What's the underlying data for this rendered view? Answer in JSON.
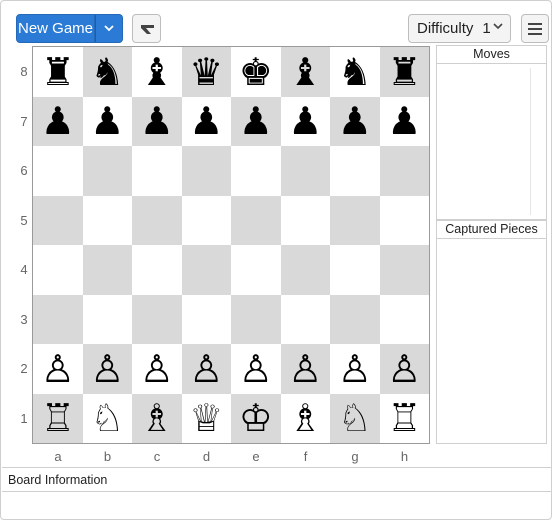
{
  "toolbar": {
    "new_game_label": "New Game",
    "difficulty_label": "Difficulty",
    "difficulty_value": "1"
  },
  "board": {
    "ranks": [
      "8",
      "7",
      "6",
      "5",
      "4",
      "3",
      "2",
      "1"
    ],
    "files": [
      "a",
      "b",
      "c",
      "d",
      "e",
      "f",
      "g",
      "h"
    ],
    "light_color": "#ffffff",
    "dark_color": "#d9d9d9",
    "position": [
      [
        "br",
        "bn",
        "bb",
        "bq",
        "bk",
        "bb",
        "bn",
        "br"
      ],
      [
        "bp",
        "bp",
        "bp",
        "bp",
        "bp",
        "bp",
        "bp",
        "bp"
      ],
      [
        "",
        "",
        "",
        "",
        "",
        "",
        "",
        ""
      ],
      [
        "",
        "",
        "",
        "",
        "",
        "",
        "",
        ""
      ],
      [
        "",
        "",
        "",
        "",
        "",
        "",
        "",
        ""
      ],
      [
        "",
        "",
        "",
        "",
        "",
        "",
        "",
        ""
      ],
      [
        "wp",
        "wp",
        "wp",
        "wp",
        "wp",
        "wp",
        "wp",
        "wp"
      ],
      [
        "wr",
        "wn",
        "wb",
        "wq",
        "wk",
        "wb",
        "wn",
        "wr"
      ]
    ]
  },
  "pieces": {
    "bk": {
      "glyph": "♚",
      "name": "black-king"
    },
    "bq": {
      "glyph": "♛",
      "name": "black-queen"
    },
    "br": {
      "glyph": "♜",
      "name": "black-rook"
    },
    "bb": {
      "glyph": "♝",
      "name": "black-bishop"
    },
    "bn": {
      "glyph": "♞",
      "name": "black-knight"
    },
    "bp": {
      "glyph": "♟",
      "name": "black-pawn"
    },
    "wk": {
      "glyph": "♔",
      "name": "white-king"
    },
    "wq": {
      "glyph": "♕",
      "name": "white-queen"
    },
    "wr": {
      "glyph": "♖",
      "name": "white-rook"
    },
    "wb": {
      "glyph": "♗",
      "name": "white-bishop"
    },
    "wn": {
      "glyph": "♘",
      "name": "white-knight"
    },
    "wp": {
      "glyph": "♙",
      "name": "white-pawn"
    }
  },
  "panels": {
    "moves_title": "Moves",
    "captured_title": "Captured Pieces"
  },
  "info": {
    "title": "Board Information"
  },
  "icons": {
    "caret": "chevron-down-icon",
    "undo": "undo-arrow-icon",
    "menu": "hamburger-menu-icon",
    "difficulty_caret": "chevron-down-icon"
  },
  "colors": {
    "accent": "#2b7bd6"
  }
}
